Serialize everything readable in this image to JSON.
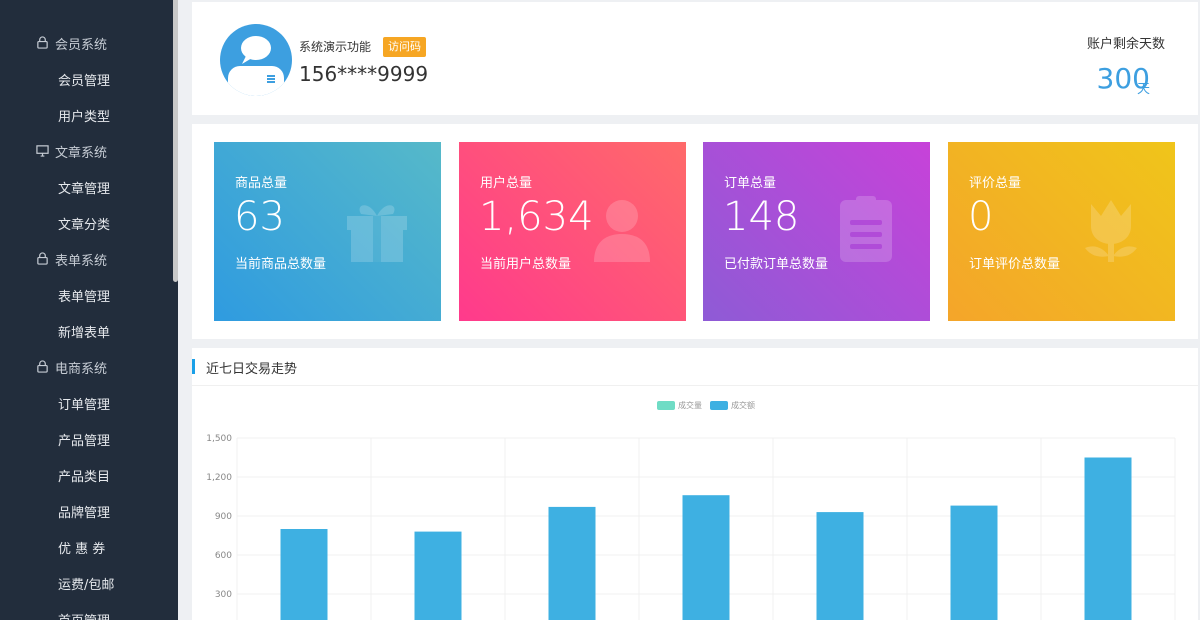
{
  "sidebar": {
    "items": [
      {
        "type": "group",
        "label": "会员系统",
        "icon": "lock-icon"
      },
      {
        "type": "item",
        "label": "会员管理"
      },
      {
        "type": "item",
        "label": "用户类型"
      },
      {
        "type": "group",
        "label": "文章系统",
        "icon": "monitor-icon"
      },
      {
        "type": "item",
        "label": "文章管理"
      },
      {
        "type": "item",
        "label": "文章分类"
      },
      {
        "type": "group",
        "label": "表单系统",
        "icon": "lock-icon"
      },
      {
        "type": "item",
        "label": "表单管理"
      },
      {
        "type": "item",
        "label": "新增表单"
      },
      {
        "type": "group",
        "label": "电商系统",
        "icon": "lock-icon"
      },
      {
        "type": "item",
        "label": "订单管理"
      },
      {
        "type": "item",
        "label": "产品管理"
      },
      {
        "type": "item",
        "label": "产品类目"
      },
      {
        "type": "item",
        "label": "品牌管理"
      },
      {
        "type": "item",
        "label": "优 惠 券"
      },
      {
        "type": "item",
        "label": "运费/包邮"
      },
      {
        "type": "item",
        "label": "首页管理"
      }
    ]
  },
  "account": {
    "demo_text": "系统演示功能",
    "badge": "访问码",
    "phone": "156****9999",
    "days_label": "账户剩余天数",
    "days_value": "300",
    "days_unit": "天"
  },
  "stats": [
    {
      "title": "商品总量",
      "value": "63",
      "desc": "当前商品总数量",
      "icon": "gift-icon",
      "gradient": [
        "#2f9be0",
        "#56b9c9"
      ]
    },
    {
      "title": "用户总量",
      "value": "1,634",
      "desc": "当前用户总数量",
      "icon": "user-icon",
      "gradient": [
        "#ff3a8c",
        "#ff6a6a"
      ]
    },
    {
      "title": "订单总量",
      "value": "148",
      "desc": "已付款订单总数量",
      "icon": "clipboard-icon",
      "gradient": [
        "#8e5bd6",
        "#c742d9"
      ]
    },
    {
      "title": "评价总量",
      "value": "0",
      "desc": "订单评价总数量",
      "icon": "tulip-icon",
      "gradient": [
        "#f4a52a",
        "#f0c51a"
      ]
    }
  ],
  "chart_panel": {
    "title": "近七日交易走势"
  },
  "chart_data": {
    "type": "bar",
    "series": [
      {
        "name": "成交量",
        "color": "#6fdcc5",
        "values": []
      },
      {
        "name": "成交额",
        "color": "#3eb0e2",
        "values": [
          800,
          780,
          970,
          1060,
          930,
          980,
          1350
        ]
      }
    ],
    "categories": [
      "",
      "",
      "",
      "",
      "",
      "",
      ""
    ],
    "y_ticks": [
      "300",
      "600",
      "900",
      "1,200",
      "1,500"
    ],
    "ylim": [
      0,
      1500
    ],
    "grid": true,
    "legend": "top-center"
  }
}
